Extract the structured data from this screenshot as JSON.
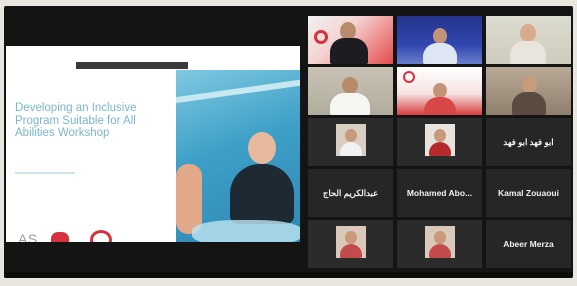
{
  "shared_screen": {
    "slide_title": "Developing an Inclusive Program Suitable for All Abilities Workshop",
    "logo_text": "AS"
  },
  "participants": [
    {
      "name": "",
      "bg": "red",
      "speaking": false
    },
    {
      "name": "",
      "bg": "blue",
      "speaking": false
    },
    {
      "name": "",
      "bg": "room",
      "speaking": true
    },
    {
      "name": "",
      "bg": "office",
      "speaking": false
    },
    {
      "name": "",
      "bg": "banner",
      "speaking": false
    },
    {
      "name": "",
      "bg": "wall",
      "speaking": false
    },
    {
      "name": "",
      "thumb": true,
      "speaking": false
    },
    {
      "name": "",
      "thumb": "red",
      "speaking": false
    },
    {
      "name": "ابو فهد ابو فهد",
      "text_only": true
    },
    {
      "name": "عبدالكريم الحاج",
      "text_only": true
    },
    {
      "name": "Mohamed Abo...",
      "text_only": true
    },
    {
      "name": "Kamal Zouaoui",
      "text_only": true
    },
    {
      "name": "",
      "thumb": "group",
      "speaking": false
    },
    {
      "name": "",
      "thumb": "group",
      "speaking": false
    },
    {
      "name": "Abeer Merza",
      "text_only": true
    }
  ]
}
